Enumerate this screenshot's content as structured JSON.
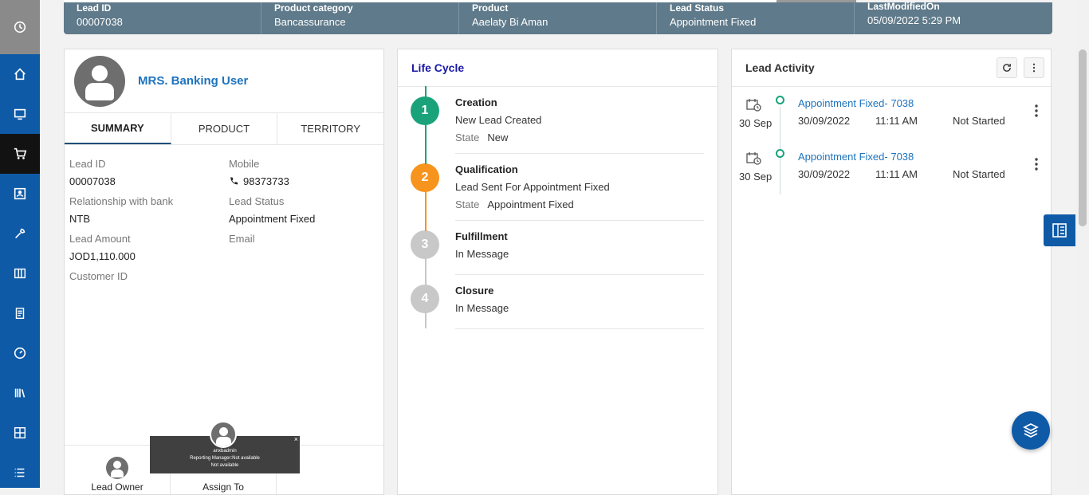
{
  "header": {
    "cells": [
      {
        "label": "Lead ID",
        "value": "00007038"
      },
      {
        "label": "Product category",
        "value": "Bancassurance"
      },
      {
        "label": "Product",
        "value": "Aaelaty Bi Aman"
      },
      {
        "label": "Lead Status",
        "value": "Appointment Fixed"
      },
      {
        "label": "LastModifiedOn",
        "value": "05/09/2022 5:29 PM"
      }
    ]
  },
  "sidebar": {
    "items": [
      "history-icon",
      "home-icon",
      "monitor-icon",
      "cart-icon",
      "contact-card-icon",
      "wrench-icon",
      "columns-icon",
      "document-icon",
      "dashboard-icon",
      "library-icon",
      "grid-icon",
      "list-icon"
    ],
    "active": "cart-icon"
  },
  "profile": {
    "name": "MRS. Banking User",
    "tabs": [
      "SUMMARY",
      "PRODUCT",
      "TERRITORY"
    ],
    "fields": [
      {
        "label": "Lead ID",
        "value": "00007038"
      },
      {
        "label": "Mobile",
        "value": "98373733"
      },
      {
        "label": "Relationship with bank",
        "value": "NTB"
      },
      {
        "label": "Lead Status",
        "value": "Appointment Fixed"
      },
      {
        "label": "Lead Amount",
        "value": "JOD1,110.000"
      },
      {
        "label": "Email",
        "value": ""
      },
      {
        "label": "Customer ID",
        "value": ""
      }
    ],
    "bottom": {
      "lead_owner": "Lead Owner",
      "assign_to": "Assign To"
    },
    "tooltip": {
      "user": "anxbadmin",
      "manager": "Reporting Manager:Not available",
      "extra": "Not available",
      "close": "×"
    }
  },
  "lifecycle": {
    "title": "Life Cycle",
    "state_label": "State",
    "stages": [
      {
        "num": "1",
        "name": "Creation",
        "desc": "New Lead Created",
        "state": "New",
        "color": "#1aa37a"
      },
      {
        "num": "2",
        "name": "Qualification",
        "desc": "Lead Sent For Appointment Fixed",
        "state": "Appointment Fixed",
        "color": "#f7941d"
      },
      {
        "num": "3",
        "name": "Fulfillment",
        "desc": "In Message",
        "state": "",
        "color": "#c8c8c8"
      },
      {
        "num": "4",
        "name": "Closure",
        "desc": "In Message",
        "state": "",
        "color": "#c8c8c8"
      }
    ]
  },
  "activity": {
    "title": "Lead Activity",
    "items": [
      {
        "date": "30 Sep",
        "title": "Appointment Fixed- 7038",
        "date2": "30/09/2022",
        "time": "11:11 AM",
        "status": "Not Started"
      },
      {
        "date": "30 Sep",
        "title": "Appointment Fixed- 7038",
        "date2": "30/09/2022",
        "time": "11:11 AM",
        "status": "Not Started"
      }
    ]
  },
  "colors": {
    "sidebar": "#0f5aa7",
    "header": "#5f7a8a",
    "accent": "#1e73be"
  }
}
